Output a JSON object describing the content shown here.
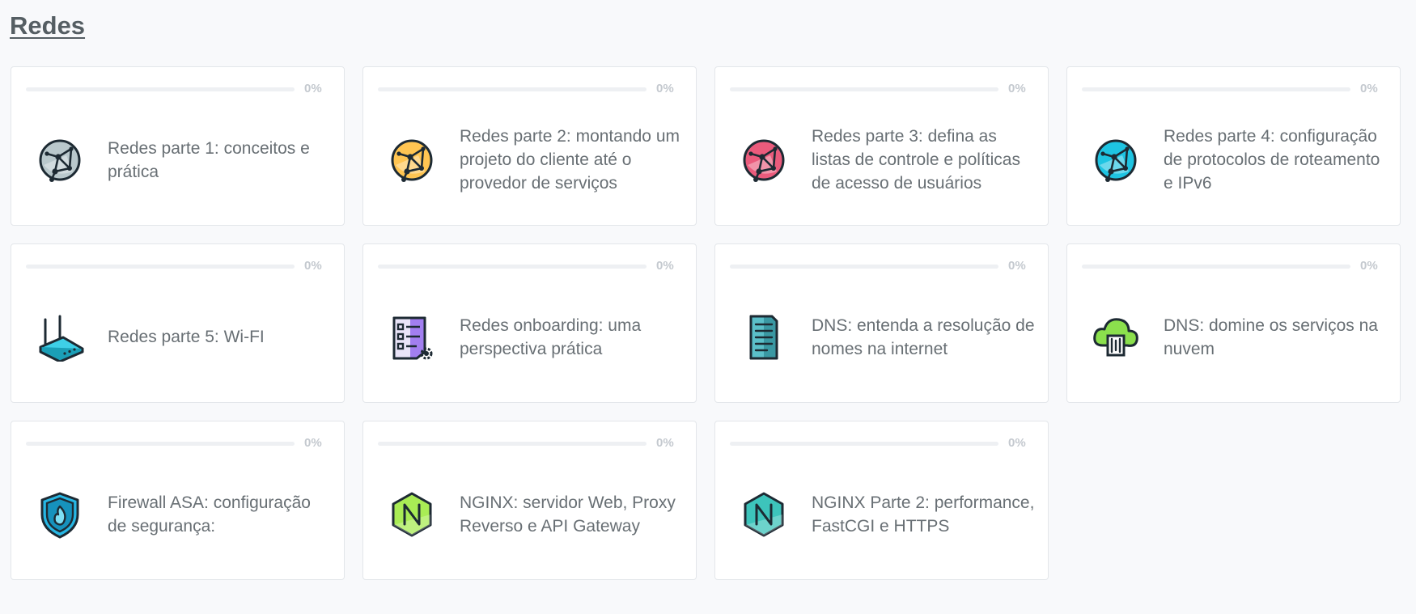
{
  "page": {
    "title": "Redes"
  },
  "courses": [
    {
      "title": "Redes parte 1: conceitos e prática",
      "progress_label": "0%",
      "progress": 0,
      "icon": "globe-network-icon",
      "color": "#b9c8cc"
    },
    {
      "title": "Redes parte 2: montando um projeto do cliente até o provedor de serviços",
      "progress_label": "0%",
      "progress": 0,
      "icon": "globe-network-icon",
      "color": "#ffc552"
    },
    {
      "title": "Redes parte 3: defina as listas de controle e políticas de acesso de usuários",
      "progress_label": "0%",
      "progress": 0,
      "icon": "globe-network-icon",
      "color": "#ea5b7c"
    },
    {
      "title": "Redes parte 4: configuração de protocolos de roteamento e IPv6",
      "progress_label": "0%",
      "progress": 0,
      "icon": "globe-network-icon",
      "color": "#1ec4e2"
    },
    {
      "title": "Redes parte 5: Wi-FI",
      "progress_label": "0%",
      "progress": 0,
      "icon": "wifi-router-icon",
      "color": "#3ecfe7"
    },
    {
      "title": "Redes onboarding: uma perspectiva prática",
      "progress_label": "0%",
      "progress": 0,
      "icon": "checklist-settings-icon",
      "color": "#a27ff0"
    },
    {
      "title": "DNS: entenda a resolução de nomes na internet",
      "progress_label": "0%",
      "progress": 0,
      "icon": "dns-document-icon",
      "color": "#5bbfc9"
    },
    {
      "title": "DNS: domine os serviços na nuvem",
      "progress_label": "0%",
      "progress": 0,
      "icon": "cloud-dns-icon",
      "color": "#8be04d"
    },
    {
      "title": "Firewall ASA: configuração de segurança:",
      "progress_label": "0%",
      "progress": 0,
      "icon": "firewall-shield-icon",
      "color": "#27b7e4"
    },
    {
      "title": "NGINX: servidor Web, Proxy Reverso e API Gateway",
      "progress_label": "0%",
      "progress": 0,
      "icon": "nginx-logo-icon",
      "color": "#a9ec55"
    },
    {
      "title": "NGINX Parte 2: performance, FastCGI e HTTPS",
      "progress_label": "0%",
      "progress": 0,
      "icon": "nginx-logo-icon",
      "color": "#3dc4bb"
    }
  ]
}
